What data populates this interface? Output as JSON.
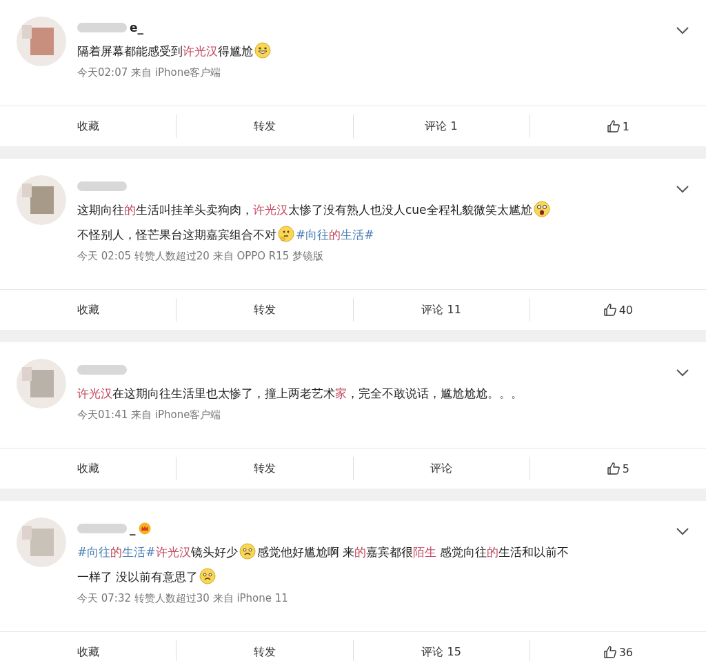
{
  "posts": [
    {
      "name_tail": "e_",
      "badge": false,
      "content": [
        [
          {
            "kind": "plain",
            "text": "隔着屏幕都能感受到"
          },
          {
            "kind": "highlight",
            "text": "许光汉"
          },
          {
            "kind": "plain",
            "text": "得尴尬"
          },
          {
            "kind": "grin"
          }
        ]
      ],
      "meta": "今天02:07  来自 iPhone客户端",
      "actions": {
        "favorite": "收藏",
        "repost": "转发",
        "comment": "评论 1",
        "like": "1"
      }
    },
    {
      "badge": false,
      "content": [
        [
          {
            "kind": "plain",
            "text": "这期向往"
          },
          {
            "kind": "highlight",
            "text": "的"
          },
          {
            "kind": "plain",
            "text": "生活叫挂羊头卖狗肉，"
          },
          {
            "kind": "highlight",
            "text": "许光汉"
          },
          {
            "kind": "plain",
            "text": "太惨了没有熟人也没人cue全程礼貌微笑太尴尬"
          },
          {
            "kind": "scared"
          }
        ],
        [
          {
            "kind": "plain",
            "text": "不怪别人，怪芒果台这期嘉宾组合不对"
          },
          {
            "kind": "think"
          },
          {
            "kind": "topic",
            "text": "#向往"
          },
          {
            "kind": "highlight",
            "text": "的"
          },
          {
            "kind": "topic",
            "text": "生活#"
          }
        ]
      ],
      "meta": "今天 02:05 转赞人数超过20  来自 OPPO R15 梦镜版",
      "actions": {
        "favorite": "收藏",
        "repost": "转发",
        "comment": "评论 11",
        "like": "40"
      }
    },
    {
      "badge": false,
      "content": [
        [
          {
            "kind": "highlight",
            "text": "许光汉"
          },
          {
            "kind": "plain",
            "text": "在这期向往生活里也太惨了，撞上两老艺术"
          },
          {
            "kind": "highlight",
            "text": "家"
          },
          {
            "kind": "plain",
            "text": "，完全不敢说话，尴尬尬尬。。。"
          }
        ]
      ],
      "meta": "今天01:41  来自 iPhone客户端",
      "actions": {
        "favorite": "收藏",
        "repost": "转发",
        "comment": "评论",
        "like": "5"
      }
    },
    {
      "name_tail": "_",
      "badge": true,
      "content": [
        [
          {
            "kind": "topic",
            "text": "#向往"
          },
          {
            "kind": "highlight",
            "text": "的"
          },
          {
            "kind": "topic",
            "text": "生活#"
          },
          {
            "kind": "highlight",
            "text": "许光汉"
          },
          {
            "kind": "plain",
            "text": "镜头好少"
          },
          {
            "kind": "sad"
          },
          {
            "kind": "plain",
            "text": "感觉他好尴尬啊 来"
          },
          {
            "kind": "highlight",
            "text": "的"
          },
          {
            "kind": "plain",
            "text": "嘉宾都很"
          },
          {
            "kind": "highlight",
            "text": "陌生"
          },
          {
            "kind": "plain",
            "text": " 感觉向往"
          },
          {
            "kind": "highlight",
            "text": "的"
          },
          {
            "kind": "plain",
            "text": "生活和以前不"
          }
        ],
        [
          {
            "kind": "plain",
            "text": "一样了 没以前有意思了"
          },
          {
            "kind": "sad"
          }
        ]
      ],
      "meta": "今天 07:32 转赞人数超过30  来自 iPhone 11",
      "actions": {
        "favorite": "收藏",
        "repost": "转发",
        "comment": "评论 15",
        "like": "36"
      }
    }
  ]
}
